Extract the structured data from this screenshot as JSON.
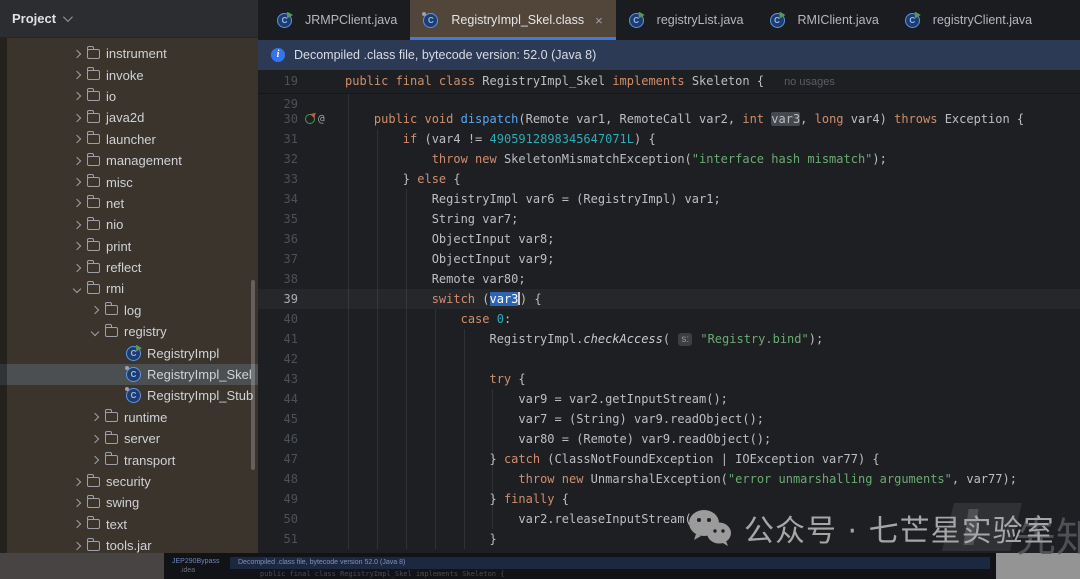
{
  "colors": {
    "accent_blue": "#3d7be0",
    "banner_bg": "#2d3a56",
    "sidebar_bg": "#3a342d",
    "active_tab_bg": "#52463a",
    "editor_bg": "#1e1f22",
    "keyword_orange": "#cf8e6d",
    "string_green": "#6aab73",
    "number_teal": "#2aacb8",
    "selection_blue": "#2e64b5"
  },
  "project_panel": {
    "title": "Project"
  },
  "sidebar": {
    "tree": [
      {
        "label": "instrument",
        "level": 0,
        "kind": "folder",
        "state": "collapsed"
      },
      {
        "label": "invoke",
        "level": 0,
        "kind": "folder",
        "state": "collapsed"
      },
      {
        "label": "io",
        "level": 0,
        "kind": "folder",
        "state": "collapsed"
      },
      {
        "label": "java2d",
        "level": 0,
        "kind": "folder",
        "state": "collapsed"
      },
      {
        "label": "launcher",
        "level": 0,
        "kind": "folder",
        "state": "collapsed"
      },
      {
        "label": "management",
        "level": 0,
        "kind": "folder",
        "state": "collapsed"
      },
      {
        "label": "misc",
        "level": 0,
        "kind": "folder",
        "state": "collapsed"
      },
      {
        "label": "net",
        "level": 0,
        "kind": "folder",
        "state": "collapsed"
      },
      {
        "label": "nio",
        "level": 0,
        "kind": "folder",
        "state": "collapsed"
      },
      {
        "label": "print",
        "level": 0,
        "kind": "folder",
        "state": "collapsed"
      },
      {
        "label": "reflect",
        "level": 0,
        "kind": "folder",
        "state": "collapsed"
      },
      {
        "label": "rmi",
        "level": 0,
        "kind": "folder",
        "state": "expanded"
      },
      {
        "label": "log",
        "level": 1,
        "kind": "folder",
        "state": "collapsed"
      },
      {
        "label": "registry",
        "level": 1,
        "kind": "folder",
        "state": "expanded"
      },
      {
        "label": "RegistryImpl",
        "level": 2,
        "kind": "class",
        "runnable": true
      },
      {
        "label": "RegistryImpl_Skel",
        "level": 2,
        "kind": "class",
        "decompiled": true,
        "selected": true
      },
      {
        "label": "RegistryImpl_Stub",
        "level": 2,
        "kind": "class",
        "decompiled": true
      },
      {
        "label": "runtime",
        "level": 1,
        "kind": "folder",
        "state": "collapsed"
      },
      {
        "label": "server",
        "level": 1,
        "kind": "folder",
        "state": "collapsed"
      },
      {
        "label": "transport",
        "level": 1,
        "kind": "folder",
        "state": "collapsed"
      },
      {
        "label": "security",
        "level": 0,
        "kind": "folder",
        "state": "collapsed"
      },
      {
        "label": "swing",
        "level": 0,
        "kind": "folder",
        "state": "collapsed"
      },
      {
        "label": "text",
        "level": 0,
        "kind": "folder",
        "state": "collapsed"
      },
      {
        "label": "tools.jar",
        "level": 0,
        "kind": "folder",
        "state": "collapsed"
      }
    ]
  },
  "tabs": [
    {
      "label": "JRMPClient.java",
      "icon": "java-class-icon",
      "active": false
    },
    {
      "label": "RegistryImpl_Skel.class",
      "icon": "decompiled-class-icon",
      "active": true,
      "close_label": "×"
    },
    {
      "label": "registryList.java",
      "icon": "java-class-icon",
      "active": false
    },
    {
      "label": "RMIClient.java",
      "icon": "java-class-icon",
      "active": false
    },
    {
      "label": "registryClient.java",
      "icon": "java-class-icon",
      "active": false
    }
  ],
  "banner": {
    "text": "Decompiled .class file, bytecode version: 52.0 (Java 8)"
  },
  "editor": {
    "sticky_line": {
      "n": "19",
      "indent": 0,
      "tokens": [
        {
          "c": "kw",
          "t": "public final class "
        },
        {
          "c": "pl",
          "t": "RegistryImpl_Skel "
        },
        {
          "c": "kw",
          "t": "implements "
        },
        {
          "c": "pl",
          "t": "Skeleton {"
        },
        {
          "c": "usage",
          "t": "no usages"
        }
      ]
    },
    "partial_line_number": "29",
    "lines": [
      {
        "n": "30",
        "indent": 4,
        "icons": [
          "override",
          "annotation"
        ],
        "tokens": [
          {
            "c": "kw",
            "t": "public void "
          },
          {
            "c": "fn",
            "t": "dispatch"
          },
          {
            "c": "pl",
            "t": "(Remote var1, RemoteCall var2, "
          },
          {
            "c": "kw",
            "t": "int "
          },
          {
            "c": "occ",
            "t": "var3"
          },
          {
            "c": "pl",
            "t": ", "
          },
          {
            "c": "kw",
            "t": "long "
          },
          {
            "c": "pl",
            "t": "var4) "
          },
          {
            "c": "kw",
            "t": "throws "
          },
          {
            "c": "pl",
            "t": "Exception {"
          }
        ]
      },
      {
        "n": "31",
        "indent": 8,
        "tokens": [
          {
            "c": "kw",
            "t": "if "
          },
          {
            "c": "pl",
            "t": "(var4 != "
          },
          {
            "c": "num",
            "t": "4905912898345647071L"
          },
          {
            "c": "pl",
            "t": ") {"
          }
        ]
      },
      {
        "n": "32",
        "indent": 12,
        "tokens": [
          {
            "c": "kw",
            "t": "throw new "
          },
          {
            "c": "pl",
            "t": "SkeletonMismatchException("
          },
          {
            "c": "str",
            "t": "\"interface hash mismatch\""
          },
          {
            "c": "pl",
            "t": ");"
          }
        ]
      },
      {
        "n": "33",
        "indent": 8,
        "tokens": [
          {
            "c": "pl",
            "t": "} "
          },
          {
            "c": "kw",
            "t": "else "
          },
          {
            "c": "pl",
            "t": "{"
          }
        ]
      },
      {
        "n": "34",
        "indent": 12,
        "tokens": [
          {
            "c": "pl",
            "t": "RegistryImpl var6 = (RegistryImpl) var1;"
          }
        ]
      },
      {
        "n": "35",
        "indent": 12,
        "tokens": [
          {
            "c": "pl",
            "t": "String var7;"
          }
        ]
      },
      {
        "n": "36",
        "indent": 12,
        "tokens": [
          {
            "c": "pl",
            "t": "ObjectInput var8;"
          }
        ]
      },
      {
        "n": "37",
        "indent": 12,
        "tokens": [
          {
            "c": "pl",
            "t": "ObjectInput var9;"
          }
        ]
      },
      {
        "n": "38",
        "indent": 12,
        "tokens": [
          {
            "c": "pl",
            "t": "Remote var80;"
          }
        ]
      },
      {
        "n": "39",
        "indent": 12,
        "current": true,
        "tokens": [
          {
            "c": "kw",
            "t": "switch "
          },
          {
            "c": "pl",
            "t": "("
          },
          {
            "c": "sel",
            "t": "var3"
          },
          {
            "c": "caret",
            "t": ""
          },
          {
            "c": "pl",
            "t": ") {"
          }
        ]
      },
      {
        "n": "40",
        "indent": 16,
        "tokens": [
          {
            "c": "kw",
            "t": "case "
          },
          {
            "c": "num",
            "t": "0"
          },
          {
            "c": "pl",
            "t": ":"
          }
        ]
      },
      {
        "n": "41",
        "indent": 20,
        "tokens": [
          {
            "c": "pl",
            "t": "RegistryImpl."
          },
          {
            "c": "it",
            "t": "checkAccess"
          },
          {
            "c": "pl",
            "t": "( "
          },
          {
            "c": "hint",
            "t": "s:"
          },
          {
            "c": "str",
            "t": " \"Registry.bind\""
          },
          {
            "c": "pl",
            "t": ");"
          }
        ]
      },
      {
        "n": "42",
        "indent": 20,
        "tokens": []
      },
      {
        "n": "43",
        "indent": 20,
        "tokens": [
          {
            "c": "kw",
            "t": "try "
          },
          {
            "c": "pl",
            "t": "{"
          }
        ]
      },
      {
        "n": "44",
        "indent": 24,
        "tokens": [
          {
            "c": "pl",
            "t": "var9 = var2.getInputStream();"
          }
        ]
      },
      {
        "n": "45",
        "indent": 24,
        "tokens": [
          {
            "c": "pl",
            "t": "var7 = (String) var9.readObject();"
          }
        ]
      },
      {
        "n": "46",
        "indent": 24,
        "tokens": [
          {
            "c": "pl",
            "t": "var80 = (Remote) var9.readObject();"
          }
        ]
      },
      {
        "n": "47",
        "indent": 20,
        "tokens": [
          {
            "c": "pl",
            "t": "} "
          },
          {
            "c": "kw",
            "t": "catch "
          },
          {
            "c": "pl",
            "t": "(ClassNotFoundException | IOException var77) {"
          }
        ]
      },
      {
        "n": "48",
        "indent": 24,
        "tokens": [
          {
            "c": "kw",
            "t": "throw new "
          },
          {
            "c": "pl",
            "t": "UnmarshalException("
          },
          {
            "c": "str",
            "t": "\"error unmarshalling arguments\""
          },
          {
            "c": "pl",
            "t": ", var77);"
          }
        ]
      },
      {
        "n": "49",
        "indent": 20,
        "tokens": [
          {
            "c": "pl",
            "t": "} "
          },
          {
            "c": "kw",
            "t": "finally "
          },
          {
            "c": "pl",
            "t": "{"
          }
        ]
      },
      {
        "n": "50",
        "indent": 24,
        "tokens": [
          {
            "c": "pl",
            "t": "var2.releaseInputStream();"
          }
        ]
      },
      {
        "n": "51",
        "indent": 20,
        "tokens": [
          {
            "c": "pl",
            "t": "}"
          }
        ]
      }
    ]
  },
  "mini_window": {
    "tree_root": "JEP290Bypass",
    "tree_child": ".idea",
    "banner": "Decompiled .class file, bytecode version 52.0 (Java 8)",
    "code": "public final class RegistryImpl_Skel implements Skeleton {"
  },
  "watermarks": {
    "wechat_text": "公众号 · 七芒星实验室",
    "background_text": "先知"
  }
}
